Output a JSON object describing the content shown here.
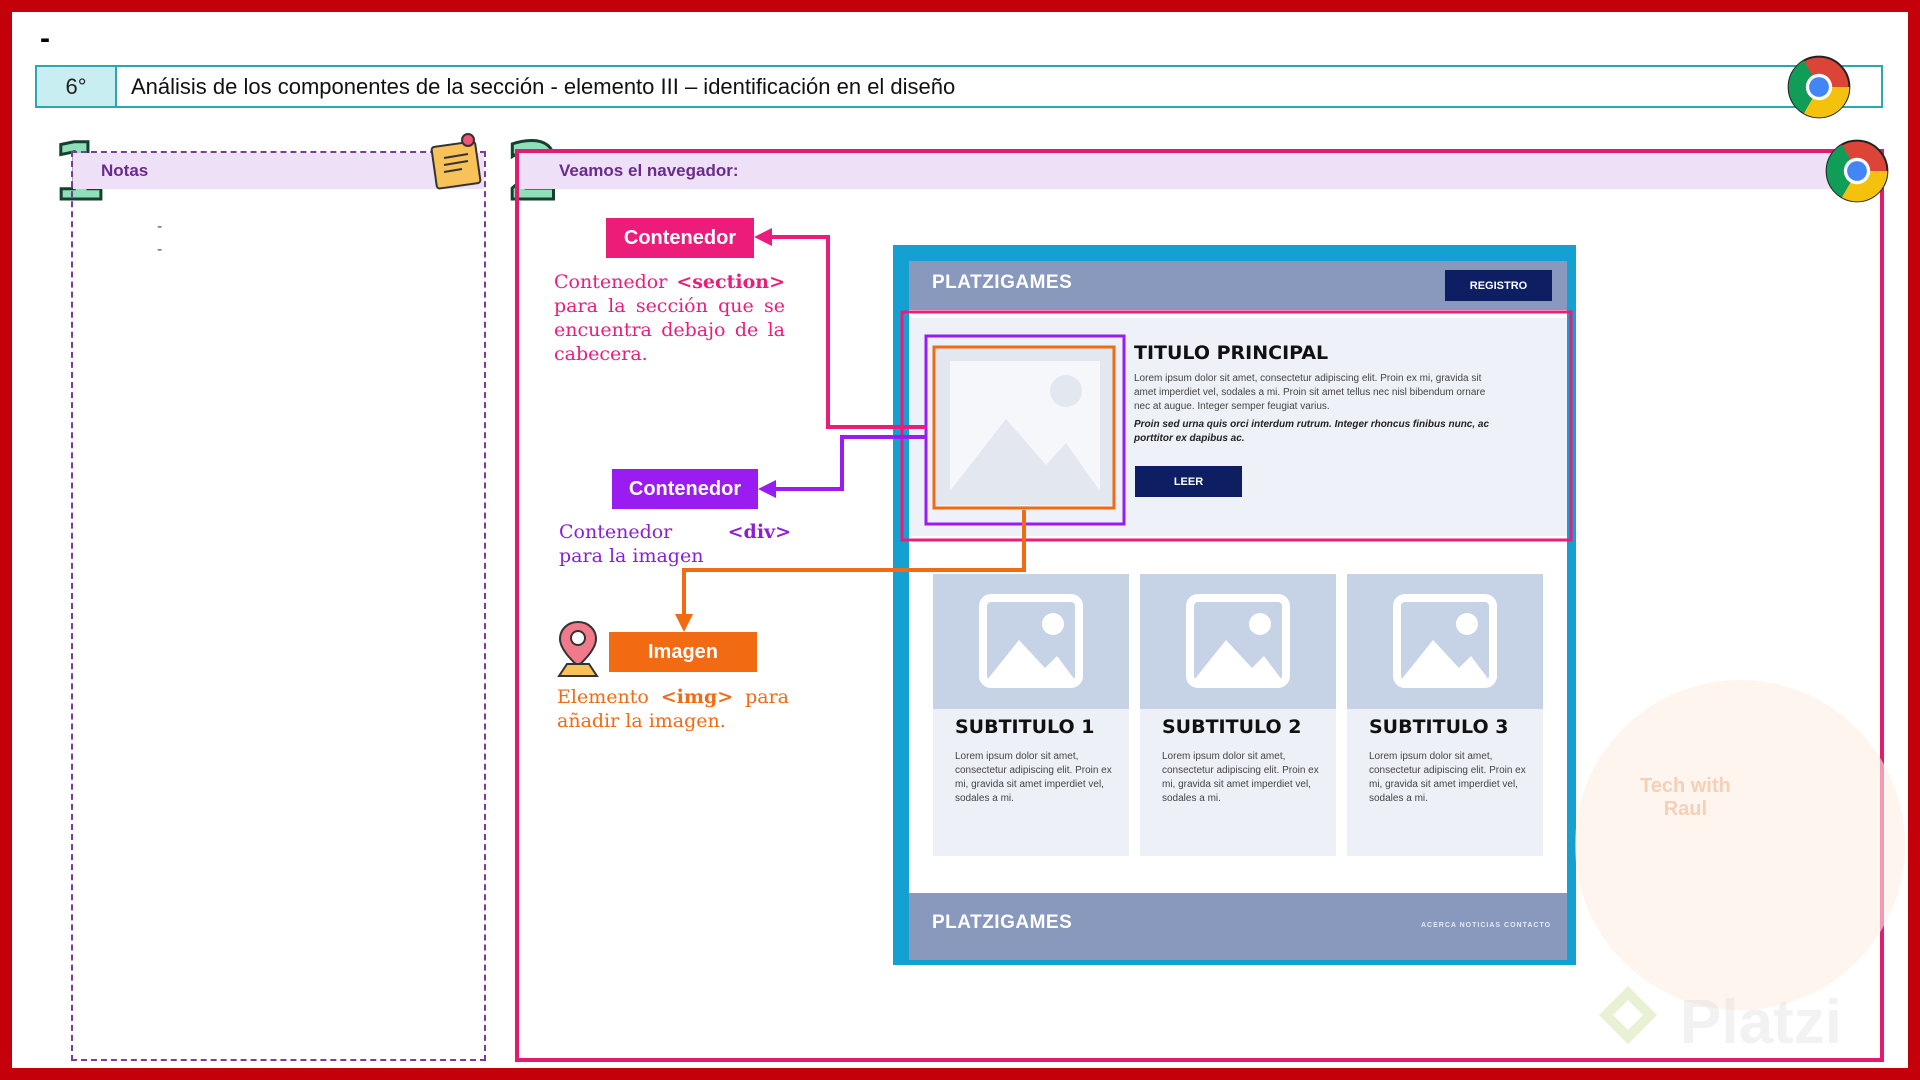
{
  "slide": {
    "top_mark": "-",
    "header": {
      "number": "6°",
      "title": "Análisis de los componentes de la sección   - elemento III – identificación en el diseño"
    }
  },
  "notes_panel": {
    "badge": "1",
    "title": "Notas",
    "items": [
      "-",
      "-"
    ]
  },
  "browser_panel": {
    "badge": "2",
    "title": "Veamos el navegador:"
  },
  "callouts": {
    "section": {
      "tag": "Contenedor",
      "text_before": "Contenedor",
      "keyword": "<section>",
      "text_after": "para la sección que se encuentra debajo de la cabecera."
    },
    "div": {
      "tag": "Contenedor",
      "text_before": "Contenedor",
      "keyword": "<div>",
      "text_after": "para la imagen"
    },
    "img": {
      "tag": "Imagen",
      "text_before": "Elemento",
      "keyword": "<img>",
      "text_after": "para añadir la imagen."
    }
  },
  "mockup": {
    "brand": "PLATZIGAMES",
    "register_button": "REGISTRO",
    "hero": {
      "title": "TITULO PRINCIPAL",
      "lorem": "Lorem ipsum dolor sit amet, consectetur adipiscing elit. Proin ex mi, gravida sit amet imperdiet vel, sodales a mi. Proin sit amet tellus nec nisl bibendum ornare nec at augue. Integer semper feugiat varius.",
      "lorem_bold": "Proin sed urna quis orci interdum rutrum. Integer rhoncus finibus nunc, ac porttitor ex dapibus ac.",
      "button": "LEER"
    },
    "cards": [
      {
        "title": "SUBTITULO 1",
        "text": "Lorem ipsum dolor sit amet, consectetur adipiscing elit. Proin ex mi, gravida sit amet imperdiet vel, sodales a mi."
      },
      {
        "title": "SUBTITULO 2",
        "text": "Lorem ipsum dolor sit amet, consectetur adipiscing elit. Proin ex mi, gravida sit amet imperdiet vel, sodales a mi."
      },
      {
        "title": "SUBTITULO 3",
        "text": "Lorem ipsum dolor sit amet, consectetur adipiscing elit. Proin ex mi, gravida sit amet imperdiet vel, sodales a mi."
      }
    ],
    "footer_brand": "PLATZIGAMES",
    "footer_links": "ACERCA  NOTICIAS  CONTACTO"
  },
  "watermark": {
    "line1": "Tech with",
    "line2": "Raul",
    "logo_text": "Platzi"
  },
  "colors": {
    "frame": "#c4000b",
    "section": "#ec1c7a",
    "div": "#9a1cf0",
    "img": "#f26a12",
    "header_accent": "#2aa7b2"
  }
}
